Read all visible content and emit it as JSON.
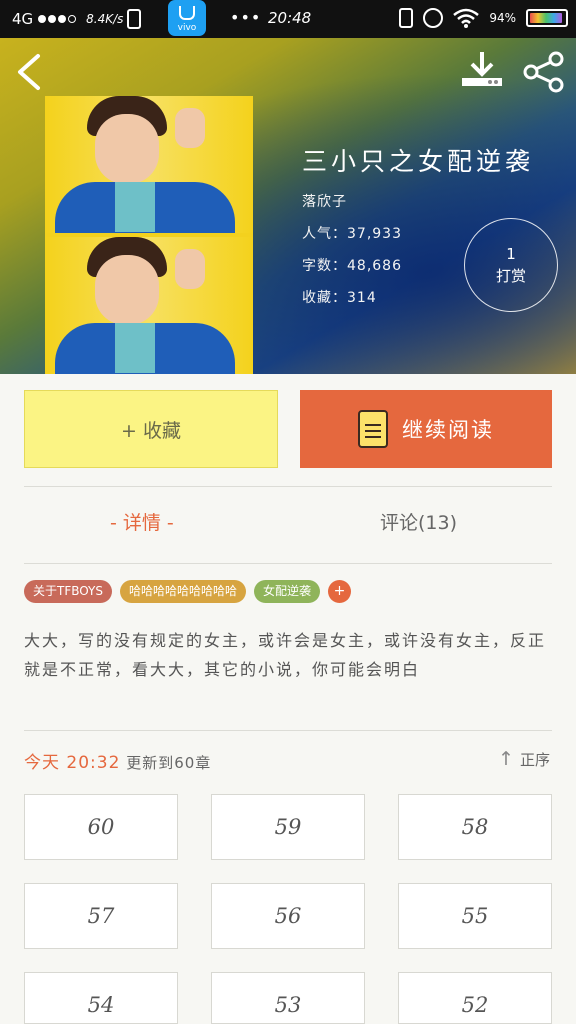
{
  "status_bar": {
    "network": "4G",
    "speed": "8.4K/s",
    "app_label": "vivo",
    "more": "•••",
    "time": "20:48",
    "battery_percent": "94%"
  },
  "book": {
    "title": "三小只之女配逆袭",
    "author": "落欣子",
    "popularity_label": "人气：",
    "popularity": "37,933",
    "word_count_label": "字数：",
    "word_count": "48,686",
    "favorites_label": "收藏：",
    "favorites": "314",
    "reward_count": "1",
    "reward_label": "打赏"
  },
  "actions": {
    "favorite_label": "+ 收藏",
    "read_label": "继续阅读"
  },
  "tabs": [
    {
      "label": "- 详情 -"
    },
    {
      "label": "评论(13)"
    }
  ],
  "tags": [
    {
      "label": "关于TFBOYS",
      "color": "#c86a5a"
    },
    {
      "label": "哈哈哈哈哈哈哈哈哈",
      "color": "#d7a440"
    },
    {
      "label": "女配逆袭",
      "color": "#8fb45a"
    },
    {
      "label": "+",
      "color": "#e5683e"
    }
  ],
  "description": "大大，写的没有规定的女主，或许会是女主，或许没有女主，反正就是不正常，看大大，其它的小说，你可能会明白",
  "update": {
    "time": "今天 20:32",
    "text": "更新到60章",
    "sort_label": "正序"
  },
  "chapters": [
    "60",
    "59",
    "58",
    "57",
    "56",
    "55",
    "54",
    "53",
    "52"
  ],
  "colors": {
    "accent": "#e5683e",
    "favorite_bg": "#fbf484"
  }
}
